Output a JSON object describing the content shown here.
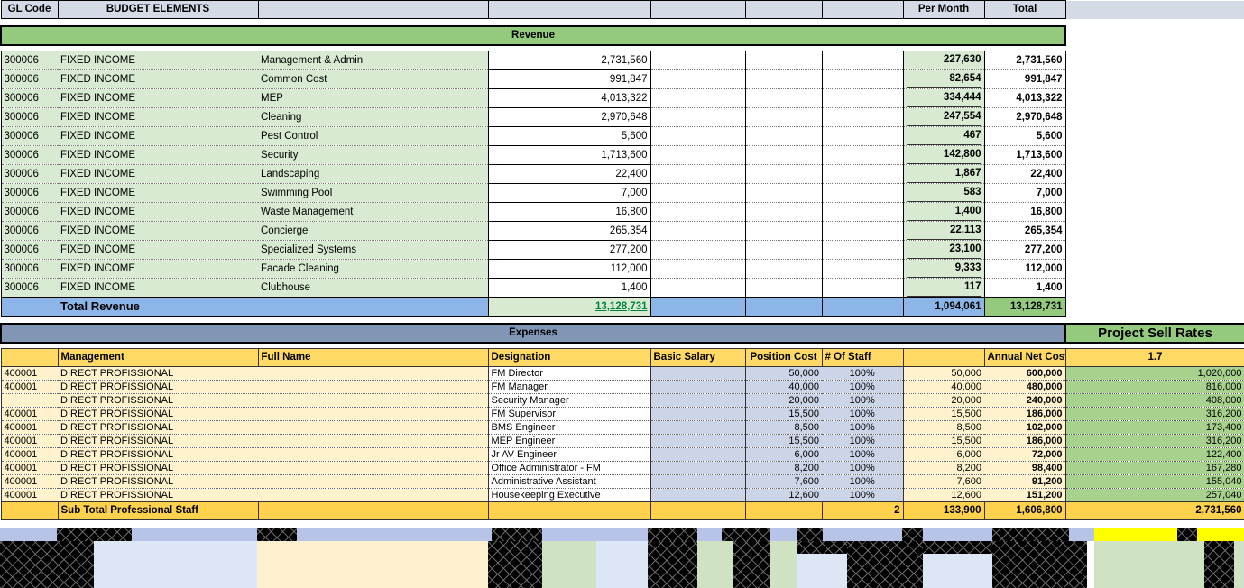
{
  "header": {
    "columns": [
      {
        "label": "GL Code"
      },
      {
        "label": "BUDGET ELEMENTS"
      },
      {
        "label": ""
      },
      {
        "label": ""
      },
      {
        "label": ""
      },
      {
        "label": ""
      },
      {
        "label": ""
      },
      {
        "label": "Per Month"
      },
      {
        "label": "Total"
      }
    ]
  },
  "revenue": {
    "band_title": "Revenue",
    "total_label": "Total Revenue",
    "total_amount": "13,128,731",
    "total_per_month": "1,094,061",
    "total_total": "13,128,731",
    "rows": [
      {
        "gl": "300006",
        "element": "FIXED INCOME",
        "item": "Management & Admin",
        "amount": "2,731,560",
        "per_month": "227,630",
        "total": "2,731,560"
      },
      {
        "gl": "300006",
        "element": "FIXED INCOME",
        "item": "Common Cost",
        "amount": "991,847",
        "per_month": "82,654",
        "total": "991,847"
      },
      {
        "gl": "300006",
        "element": "FIXED INCOME",
        "item": "MEP",
        "amount": "4,013,322",
        "per_month": "334,444",
        "total": "4,013,322"
      },
      {
        "gl": "300006",
        "element": "FIXED INCOME",
        "item": "Cleaning",
        "amount": "2,970,648",
        "per_month": "247,554",
        "total": "2,970,648"
      },
      {
        "gl": "300006",
        "element": "FIXED INCOME",
        "item": "Pest Control",
        "amount": "5,600",
        "per_month": "467",
        "total": "5,600"
      },
      {
        "gl": "300006",
        "element": "FIXED INCOME",
        "item": "Security",
        "amount": "1,713,600",
        "per_month": "142,800",
        "total": "1,713,600"
      },
      {
        "gl": "300006",
        "element": "FIXED INCOME",
        "item": "Landscaping",
        "amount": "22,400",
        "per_month": "1,867",
        "total": "22,400"
      },
      {
        "gl": "300006",
        "element": "FIXED INCOME",
        "item": "Swimming Pool",
        "amount": "7,000",
        "per_month": "583",
        "total": "7,000"
      },
      {
        "gl": "300006",
        "element": "FIXED INCOME",
        "item": "Waste Management",
        "amount": "16,800",
        "per_month": "1,400",
        "total": "16,800"
      },
      {
        "gl": "300006",
        "element": "FIXED INCOME",
        "item": "Concierge",
        "amount": "265,354",
        "per_month": "22,113",
        "total": "265,354"
      },
      {
        "gl": "300006",
        "element": "FIXED INCOME",
        "item": "Specialized Systems",
        "amount": "277,200",
        "per_month": "23,100",
        "total": "277,200"
      },
      {
        "gl": "300006",
        "element": "FIXED INCOME",
        "item": "Facade Cleaning",
        "amount": "112,000",
        "per_month": "9,333",
        "total": "112,000"
      },
      {
        "gl": "300006",
        "element": "FIXED INCOME",
        "item": "Clubhouse",
        "amount": "1,400",
        "per_month": "117",
        "total": "1,400"
      }
    ]
  },
  "expenses": {
    "band_title": "Expenses",
    "sell_rates_title": "Project Sell Rates",
    "sell_rate_value": "1.7",
    "subheader": {
      "gl": "",
      "management": "Management",
      "full_name": "Full Name",
      "designation": "Designation",
      "basic_salary": "Basic Salary",
      "position_cost": "Position Cost",
      "num_staff": "# Of Staff",
      "blank": "",
      "annual_net_cost": "Annual Net Cost"
    },
    "rows": [
      {
        "gl": "400001",
        "management": "DIRECT PROFISSIONAL",
        "full_name": "",
        "designation": "FM Director",
        "basic_salary": "",
        "position_cost": "50,000",
        "num_staff": "100%",
        "monthly": "50,000",
        "annual_net_cost": "600,000",
        "sell": "1,020,000"
      },
      {
        "gl": "400001",
        "management": "DIRECT PROFISSIONAL",
        "full_name": "",
        "designation": "FM Manager",
        "basic_salary": "",
        "position_cost": "40,000",
        "num_staff": "100%",
        "monthly": "40,000",
        "annual_net_cost": "480,000",
        "sell": "816,000"
      },
      {
        "gl": "",
        "management": "DIRECT PROFISSIONAL",
        "full_name": "",
        "designation": "Security Manager",
        "basic_salary": "",
        "position_cost": "20,000",
        "num_staff": "100%",
        "monthly": "20,000",
        "annual_net_cost": "240,000",
        "sell": "408,000"
      },
      {
        "gl": "400001",
        "management": "DIRECT PROFISSIONAL",
        "full_name": "",
        "designation": "FM Supervisor",
        "basic_salary": "",
        "position_cost": "15,500",
        "num_staff": "100%",
        "monthly": "15,500",
        "annual_net_cost": "186,000",
        "sell": "316,200"
      },
      {
        "gl": "400001",
        "management": "DIRECT PROFISSIONAL",
        "full_name": "",
        "designation": "BMS Engineer",
        "basic_salary": "",
        "position_cost": "8,500",
        "num_staff": "100%",
        "monthly": "8,500",
        "annual_net_cost": "102,000",
        "sell": "173,400"
      },
      {
        "gl": "400001",
        "management": "DIRECT PROFISSIONAL",
        "full_name": "",
        "designation": "MEP Engineer",
        "basic_salary": "",
        "position_cost": "15,500",
        "num_staff": "100%",
        "monthly": "15,500",
        "annual_net_cost": "186,000",
        "sell": "316,200"
      },
      {
        "gl": "400001",
        "management": "DIRECT PROFISSIONAL",
        "full_name": "",
        "designation": "Jr AV Engineer",
        "basic_salary": "",
        "position_cost": "6,000",
        "num_staff": "100%",
        "monthly": "6,000",
        "annual_net_cost": "72,000",
        "sell": "122,400"
      },
      {
        "gl": "400001",
        "management": "DIRECT PROFISSIONAL",
        "full_name": "",
        "designation": "Office Administrator - FM",
        "basic_salary": "",
        "position_cost": "8,200",
        "num_staff": "100%",
        "monthly": "8,200",
        "annual_net_cost": "98,400",
        "sell": "167,280"
      },
      {
        "gl": "400001",
        "management": "DIRECT PROFISSIONAL",
        "full_name": "",
        "designation": "Administrative Assistant",
        "basic_salary": "",
        "position_cost": "7,600",
        "num_staff": "100%",
        "monthly": "7,600",
        "annual_net_cost": "91,200",
        "sell": "155,040"
      },
      {
        "gl": "400001",
        "management": "DIRECT PROFISSIONAL",
        "full_name": "",
        "designation": "Housekeeping Executive",
        "basic_salary": "",
        "position_cost": "12,600",
        "num_staff": "100%",
        "monthly": "12,600",
        "annual_net_cost": "151,200",
        "sell": "257,040"
      }
    ],
    "subtotal": {
      "label": "Sub Total Professional Staff",
      "num_staff": "2",
      "monthly": "133,900",
      "annual_net_cost": "1,606,800",
      "sell": "2,731,560"
    }
  },
  "colors": {
    "revenue_band": "#93ca7d",
    "revenue_fill": "#d9ead3",
    "expenses_band": "#8196b5",
    "expense_header": "#ffd966",
    "expense_fill": "#fff2cc",
    "expense_blue": "#ccd5e8",
    "sell_rate_highlight": "#ffff00",
    "total_row_blue": "#8cb6e8",
    "header_blue": "#d4dae6",
    "redaction": "#000000"
  }
}
